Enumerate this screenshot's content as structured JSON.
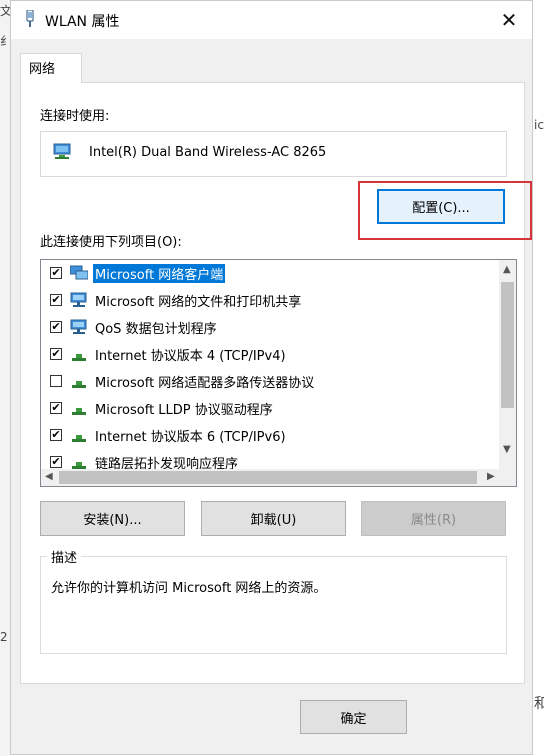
{
  "background": {
    "left_fragments": [
      "文",
      "纟",
      "2"
    ],
    "right_fragments": [
      "ic",
      "和"
    ]
  },
  "window": {
    "title": "WLAN 属性",
    "close_glyph": "✕"
  },
  "tabs": [
    {
      "label": "网络"
    }
  ],
  "connect_using": {
    "label": "连接时使用:",
    "adapter": "Intel(R) Dual Band Wireless-AC 8265",
    "configure_button": "配置(C)..."
  },
  "items_section": {
    "label": "此连接使用下列项目(O):",
    "items": [
      {
        "label": "Microsoft 网络客户端",
        "checked": true,
        "selected": true,
        "icon": "network-client-icon"
      },
      {
        "label": "Microsoft 网络的文件和打印机共享",
        "checked": true,
        "selected": false,
        "icon": "file-sharing-icon"
      },
      {
        "label": "QoS 数据包计划程序",
        "checked": true,
        "selected": false,
        "icon": "qos-icon"
      },
      {
        "label": "Internet 协议版本 4 (TCP/IPv4)",
        "checked": true,
        "selected": false,
        "icon": "protocol-icon"
      },
      {
        "label": "Microsoft 网络适配器多路传送器协议",
        "checked": false,
        "selected": false,
        "icon": "protocol-icon"
      },
      {
        "label": "Microsoft LLDP 协议驱动程序",
        "checked": true,
        "selected": false,
        "icon": "protocol-icon"
      },
      {
        "label": "Internet 协议版本 6 (TCP/IPv6)",
        "checked": true,
        "selected": false,
        "icon": "protocol-icon"
      },
      {
        "label": "链路层拓扑发现响应程序",
        "checked": true,
        "selected": false,
        "icon": "protocol-icon"
      }
    ]
  },
  "buttons": {
    "install": "安装(N)...",
    "uninstall": "卸载(U)",
    "properties": "属性(R)",
    "ok": "确定"
  },
  "description": {
    "title": "描述",
    "text": "允许你的计算机访问 Microsoft 网络上的资源。"
  },
  "colors": {
    "accent": "#0078d7",
    "highlight_border": "#d6343b"
  }
}
